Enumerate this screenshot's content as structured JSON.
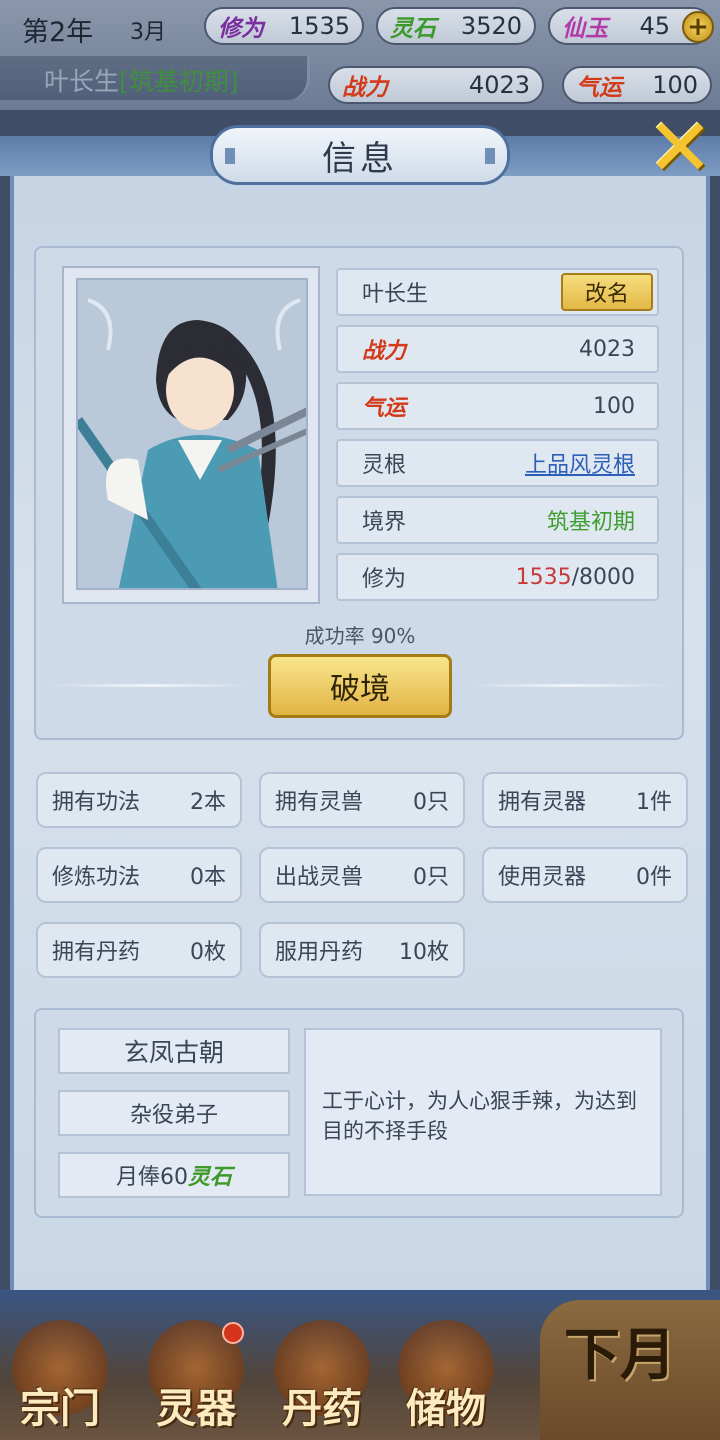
{
  "hud": {
    "year": "第2年",
    "month": "3月",
    "cultivation_label": "修为",
    "cultivation_value": "1535",
    "spirit_stone_label": "灵石",
    "spirit_stone_value": "3520",
    "jade_label": "仙玉",
    "jade_value": "45",
    "power_label": "战力",
    "power_value": "4023",
    "luck_label": "气运",
    "luck_value": "100",
    "player_name": "叶长生",
    "player_realm": "[筑基初期]"
  },
  "panel": {
    "title": "信息",
    "name": "叶长生",
    "rename_label": "改名",
    "power_label": "战力",
    "power_value": "4023",
    "luck_label": "气运",
    "luck_value": "100",
    "root_label": "灵根",
    "root_value": "上品风灵根",
    "realm_label": "境界",
    "realm_value": "筑基初期",
    "cultivation_label": "修为",
    "cultivation_current": "1535",
    "cultivation_max": "/8000",
    "success_rate": "成功率 90%",
    "breakthrough_label": "破境"
  },
  "counts": [
    {
      "label": "拥有功法",
      "value": "2本"
    },
    {
      "label": "拥有灵兽",
      "value": "0只"
    },
    {
      "label": "拥有灵器",
      "value": "1件"
    },
    {
      "label": "修炼功法",
      "value": "0本"
    },
    {
      "label": "出战灵兽",
      "value": "0只"
    },
    {
      "label": "使用灵器",
      "value": "0件"
    },
    {
      "label": "拥有丹药",
      "value": "0枚"
    },
    {
      "label": "服用丹药",
      "value": "10枚"
    }
  ],
  "sect": {
    "name": "玄凤古朝",
    "rank": "杂役弟子",
    "salary_prefix": "月俸60",
    "salary_unit": "灵石",
    "description": "工于心计，为人心狠手辣，为达到目的不择手段"
  },
  "nav": {
    "sect": "宗门",
    "artifact": "灵器",
    "pill": "丹药",
    "storage": "储物",
    "next_month": "下月"
  },
  "colors": {
    "gold": "#e2b846",
    "power_red": "#d23a1a",
    "realm_green": "#3f9e2f",
    "link_blue": "#2b5fb8",
    "panel_blue": "#6f8fb8"
  }
}
